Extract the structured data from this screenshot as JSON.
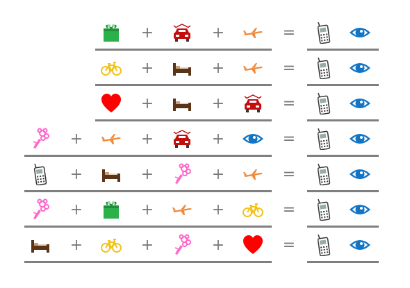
{
  "colors": {
    "line": "#7f7f7f",
    "operator": "#7a7a7a",
    "gift-icon": "#2bb14a",
    "car-icon": "#c40e0e",
    "plane-icon": "#f08a3a",
    "bike-icon": "#f2c21b",
    "bed-icon": "#5b3418",
    "heart-icon": "#ff0000",
    "bouquet-icon": "#ff66cc",
    "phone-icon": "#333333",
    "eye-icon": "#1175c7"
  },
  "operators": {
    "plus": "+",
    "equals": "="
  },
  "rows": [
    {
      "lhs": [
        "gift-icon",
        "car-icon",
        "plane-icon"
      ],
      "rhs": [
        "phone-icon",
        "eye-icon"
      ]
    },
    {
      "lhs": [
        "bike-icon",
        "bed-icon",
        "plane-icon"
      ],
      "rhs": [
        "phone-icon",
        "eye-icon"
      ]
    },
    {
      "lhs": [
        "heart-icon",
        "bed-icon",
        "car-icon"
      ],
      "rhs": [
        "phone-icon",
        "eye-icon"
      ]
    },
    {
      "lhs": [
        "bouquet-icon",
        "plane-icon",
        "car-icon",
        "eye-icon"
      ],
      "rhs": [
        "phone-icon",
        "eye-icon"
      ]
    },
    {
      "lhs": [
        "phone-icon",
        "bed-icon",
        "bouquet-icon",
        "plane-icon"
      ],
      "rhs": [
        "phone-icon",
        "eye-icon"
      ]
    },
    {
      "lhs": [
        "bouquet-icon",
        "gift-icon",
        "plane-icon",
        "bike-icon"
      ],
      "rhs": [
        "phone-icon",
        "eye-icon"
      ]
    },
    {
      "lhs": [
        "bed-icon",
        "bike-icon",
        "bouquet-icon",
        "heart-icon"
      ],
      "rhs": [
        "phone-icon",
        "eye-icon"
      ]
    }
  ]
}
